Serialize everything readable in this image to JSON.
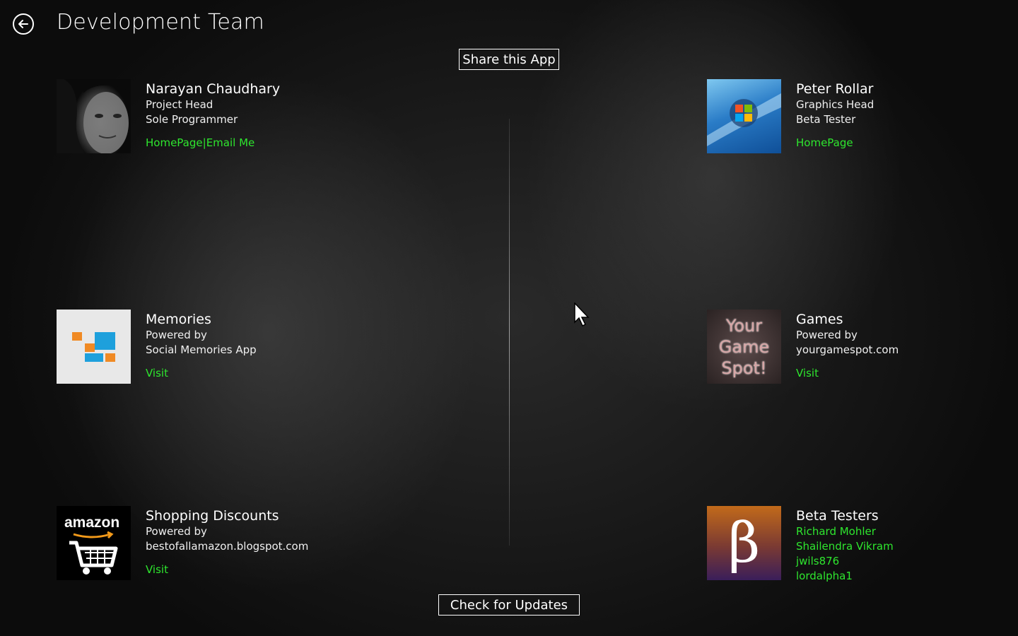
{
  "header": {
    "title": "Development Team",
    "share_label": "Share this App"
  },
  "footer": {
    "update_label": "Check for Updates"
  },
  "cards": [
    {
      "name": "Narayan Chaudhary",
      "lines": [
        "Project Head",
        "Sole Programmer"
      ],
      "links": [
        "HomePage",
        "Email Me"
      ],
      "link_separator": "|"
    },
    {
      "name": "Peter Rollar",
      "lines": [
        "Graphics Head",
        "Beta Tester"
      ],
      "links": [
        "HomePage"
      ]
    },
    {
      "name": "Memories",
      "lines": [
        "Powered by",
        "Social Memories App"
      ],
      "links": [
        "Visit"
      ]
    },
    {
      "name": "Games",
      "lines": [
        "Powered by",
        "yourgamespot.com"
      ],
      "links": [
        "Visit"
      ],
      "logo_words": [
        "Your",
        "Game",
        "Spot!"
      ]
    },
    {
      "name": "Shopping Discounts",
      "lines": [
        "Powered by",
        "bestofallamazon.blogspot.com"
      ],
      "links": [
        "Visit"
      ],
      "logo_word": "amazon"
    },
    {
      "name": "Beta Testers",
      "testers": [
        "Richard Mohler",
        "Shailendra Vikram",
        "jwils876",
        "lordalpha1"
      ],
      "logo_glyph": "β"
    }
  ],
  "colors": {
    "link": "#2ee62e",
    "text": "#ffffff",
    "background": "#1a1a1a"
  },
  "icons": {
    "back": "back-arrow-icon",
    "cursor": "mouse-pointer-icon"
  }
}
